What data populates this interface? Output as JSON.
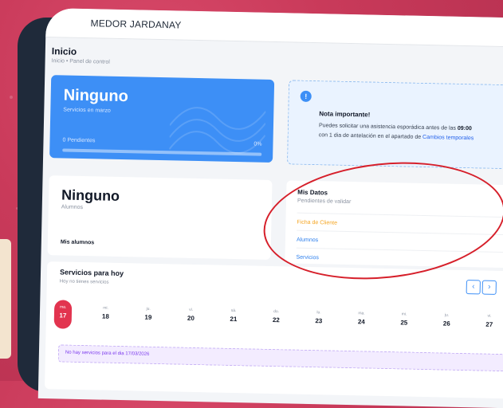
{
  "header": {
    "name": "MEDOR JARDANAY"
  },
  "breadcrumb": {
    "title": "Inicio",
    "path": "Inicio • Panel de control"
  },
  "services_card": {
    "value": "Ninguno",
    "label": "Servicios en marzo",
    "pending": "0 Pendientes",
    "percent": "0%",
    "progress": 0
  },
  "note": {
    "icon": "!",
    "title": "Nota importante!",
    "line1_a": "Puedes solicitar una asistencia esporádica antes de las ",
    "line1_b": "09:00",
    "line2_a": "con 1 dia de antelación en el apartado de ",
    "line2_link": "Cambios temporales"
  },
  "alumnos_card": {
    "value": "Ninguno",
    "label": "Alumnos",
    "my_students": "Mis alumnos"
  },
  "datos": {
    "title": "Mis Datos",
    "subtitle": "Pendientes de validar",
    "items": [
      {
        "label": "Ficha de Cliente",
        "color": "#f5a623"
      },
      {
        "label": "Alumnos",
        "color": "#2f80ed"
      },
      {
        "label": "Servicios",
        "color": "#2f80ed"
      }
    ]
  },
  "services_today": {
    "title": "Servicios para hoy",
    "subtitle": "Hoy no tienes servicios",
    "prev": "‹",
    "next": "›",
    "days": [
      {
        "dow": "ma.",
        "num": "17"
      },
      {
        "dow": "mi.",
        "num": "18"
      },
      {
        "dow": "ju.",
        "num": "19"
      },
      {
        "dow": "vi.",
        "num": "20"
      },
      {
        "dow": "sá.",
        "num": "21"
      },
      {
        "dow": "do.",
        "num": "22"
      },
      {
        "dow": "lu.",
        "num": "23"
      },
      {
        "dow": "ma.",
        "num": "24"
      },
      {
        "dow": "mi.",
        "num": "25"
      },
      {
        "dow": "ju.",
        "num": "26"
      },
      {
        "dow": "vi.",
        "num": "27"
      }
    ],
    "empty_message": "No hay servicios para el dia 17/03/2026"
  },
  "colors": {
    "accent": "#3d8ff6",
    "selected_day": "#e2344f",
    "annotation": "#d61f2a"
  }
}
